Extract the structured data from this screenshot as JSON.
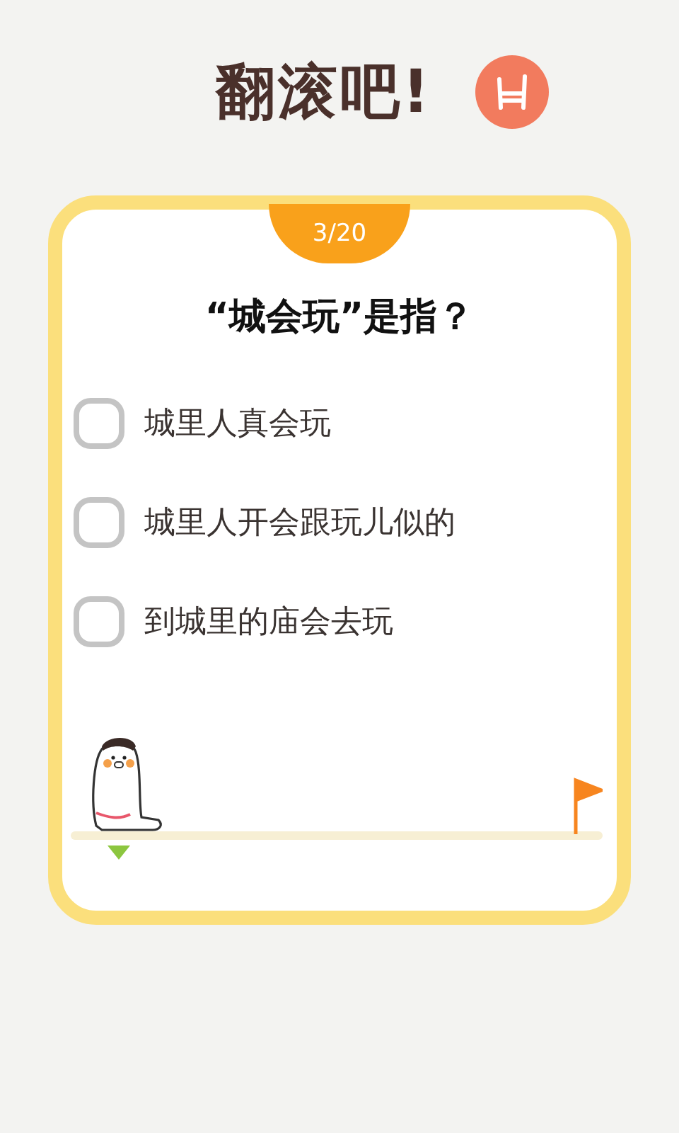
{
  "header": {
    "title": "翻滚吧!"
  },
  "quiz": {
    "counter": "3/20",
    "question": "“城会玩”是指？",
    "options": [
      {
        "label": "城里人真会玩",
        "selected": false
      },
      {
        "label": "城里人开会跟玩儿似的",
        "selected": false
      },
      {
        "label": "到城里的庙会去玩",
        "selected": false
      }
    ],
    "progress": {
      "level": 0.09
    }
  }
}
